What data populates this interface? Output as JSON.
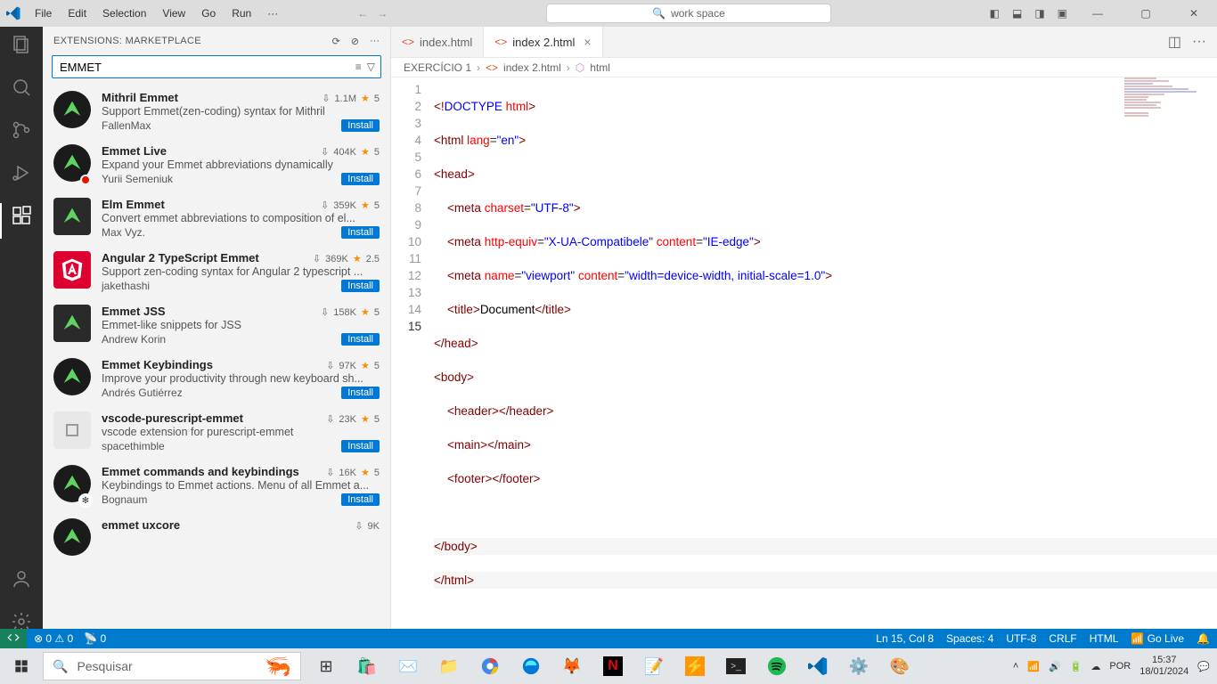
{
  "menu": {
    "file": "File",
    "edit": "Edit",
    "selection": "Selection",
    "view": "View",
    "go": "Go",
    "run": "Run",
    "more": "···"
  },
  "titlebar": {
    "search": "work space"
  },
  "sidebar": {
    "title": "EXTENSIONS: MARKETPLACE",
    "search_value": "EMMET"
  },
  "extensions": [
    {
      "name": "Mithril Emmet",
      "desc": "Support Emmet(zen-coding) syntax for Mithril",
      "author": "FallenMax",
      "downloads": "1.1M",
      "rating": "5",
      "bg": "#1b1b1b",
      "shape": "circle"
    },
    {
      "name": "Emmet Live",
      "desc": "Expand your Emmet abbreviations dynamically",
      "author": "Yurii Semeniuk",
      "downloads": "404K",
      "rating": "5",
      "bg": "#1b1b1b",
      "shape": "circle",
      "badge": true
    },
    {
      "name": "Elm Emmet",
      "desc": "Convert emmet abbreviations to composition of el...",
      "author": "Max Vyz.",
      "downloads": "359K",
      "rating": "5",
      "bg": "#2a2a2a",
      "shape": "square"
    },
    {
      "name": "Angular 2 TypeScript Emmet",
      "desc": "Support zen-coding syntax for Angular 2 typescript ...",
      "author": "jakethashi",
      "downloads": "369K",
      "rating": "2.5",
      "bg": "#dd0031",
      "shape": "square"
    },
    {
      "name": "Emmet JSS",
      "desc": "Emmet-like snippets for JSS",
      "author": "Andrew Korin",
      "downloads": "158K",
      "rating": "5",
      "bg": "#2a2a2a",
      "shape": "square"
    },
    {
      "name": "Emmet Keybindings",
      "desc": "Improve your productivity through new keyboard sh...",
      "author": "Andrés Gutiérrez",
      "downloads": "97K",
      "rating": "5",
      "bg": "#1b1b1b",
      "shape": "circle"
    },
    {
      "name": "vscode-purescript-emmet",
      "desc": "vscode extension for purescript-emmet",
      "author": "spacethimble",
      "downloads": "23K",
      "rating": "5",
      "bg": "#e8e8e8",
      "shape": "square"
    },
    {
      "name": "Emmet commands and keybindings",
      "desc": "Keybindings to Emmet actions. Menu of all Emmet a...",
      "author": "Bognaum",
      "downloads": "16K",
      "rating": "5",
      "bg": "#1b1b1b",
      "shape": "circle",
      "badge2": true
    },
    {
      "name": "emmet uxcore",
      "desc": "",
      "author": "",
      "downloads": "9K",
      "rating": "",
      "bg": "#1b1b1b",
      "shape": "circle"
    }
  ],
  "install_label": "Install",
  "tabs": [
    {
      "label": "index.html",
      "active": false
    },
    {
      "label": "index 2.html",
      "active": true
    }
  ],
  "breadcrumb": {
    "folder": "EXERCÍCIO 1",
    "file": "index 2.html",
    "symbol": "html"
  },
  "lines": [
    1,
    2,
    3,
    4,
    5,
    6,
    7,
    8,
    9,
    10,
    11,
    12,
    13,
    14,
    15
  ],
  "current_line": 15,
  "code": {
    "l1": "<!DOCTYPE html>",
    "l7_title": "Document"
  },
  "status": {
    "errors": "0",
    "warnings": "0",
    "ports": "0",
    "ln_col": "Ln 15, Col 8",
    "spaces": "Spaces: 4",
    "encoding": "UTF-8",
    "eol": "CRLF",
    "lang": "HTML",
    "golive": "Go Live"
  },
  "taskbar": {
    "search_placeholder": "Pesquisar",
    "lang": "POR",
    "time": "15:37",
    "date": "18/01/2024"
  }
}
